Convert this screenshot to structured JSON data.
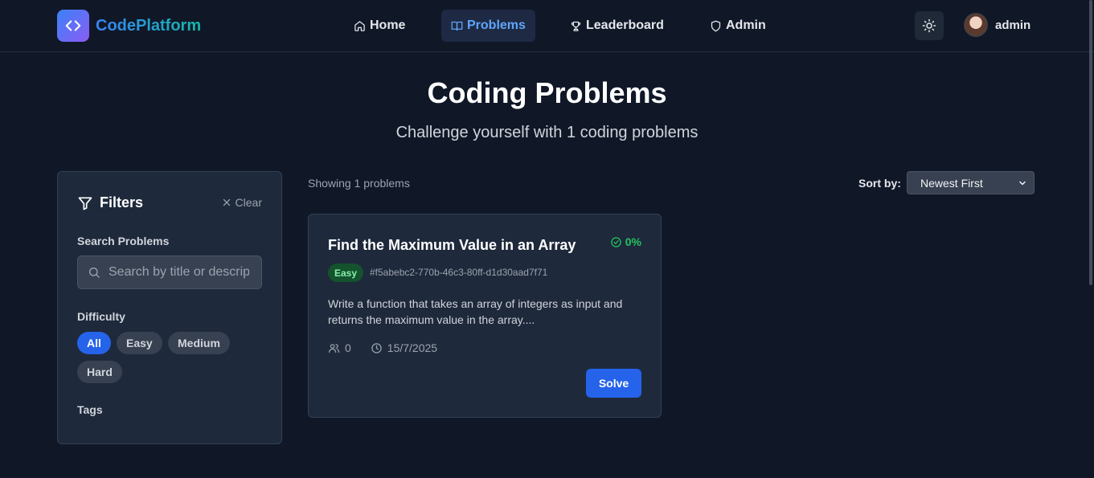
{
  "brand": {
    "name": "CodePlatform",
    "logo_icon": "code-icon"
  },
  "nav": {
    "items": [
      {
        "label": "Home",
        "icon": "home-icon",
        "active": false
      },
      {
        "label": "Problems",
        "icon": "book-icon",
        "active": true
      },
      {
        "label": "Leaderboard",
        "icon": "trophy-icon",
        "active": false
      },
      {
        "label": "Admin",
        "icon": "shield-icon",
        "active": false
      }
    ]
  },
  "header": {
    "theme_icon": "sun-icon",
    "user_name": "admin"
  },
  "hero": {
    "title": "Coding Problems",
    "subtitle": "Challenge yourself with 1 coding problems"
  },
  "filters": {
    "title": "Filters",
    "clear_label": "Clear",
    "search_label": "Search Problems",
    "search_placeholder": "Search by title or description...",
    "difficulty_label": "Difficulty",
    "difficulty_options": [
      "All",
      "Easy",
      "Medium",
      "Hard"
    ],
    "difficulty_selected": "All",
    "tags_label": "Tags"
  },
  "list": {
    "showing_text": "Showing 1 problems",
    "sort_label": "Sort by:",
    "sort_value": "Newest First"
  },
  "problems": [
    {
      "title": "Find the Maximum Value in an Array",
      "acceptance": "0%",
      "difficulty": "Easy",
      "id": "#f5abebc2-770b-46c3-80ff-d1d30aad7f71",
      "description": "Write a function that takes an array of integers as input and returns the maximum value in the array....",
      "submissions": "0",
      "date": "15/7/2025",
      "action_label": "Solve"
    }
  ],
  "colors": {
    "background": "#101828",
    "card": "#1e293b",
    "accent": "#2563eb",
    "success": "#22c55e"
  }
}
